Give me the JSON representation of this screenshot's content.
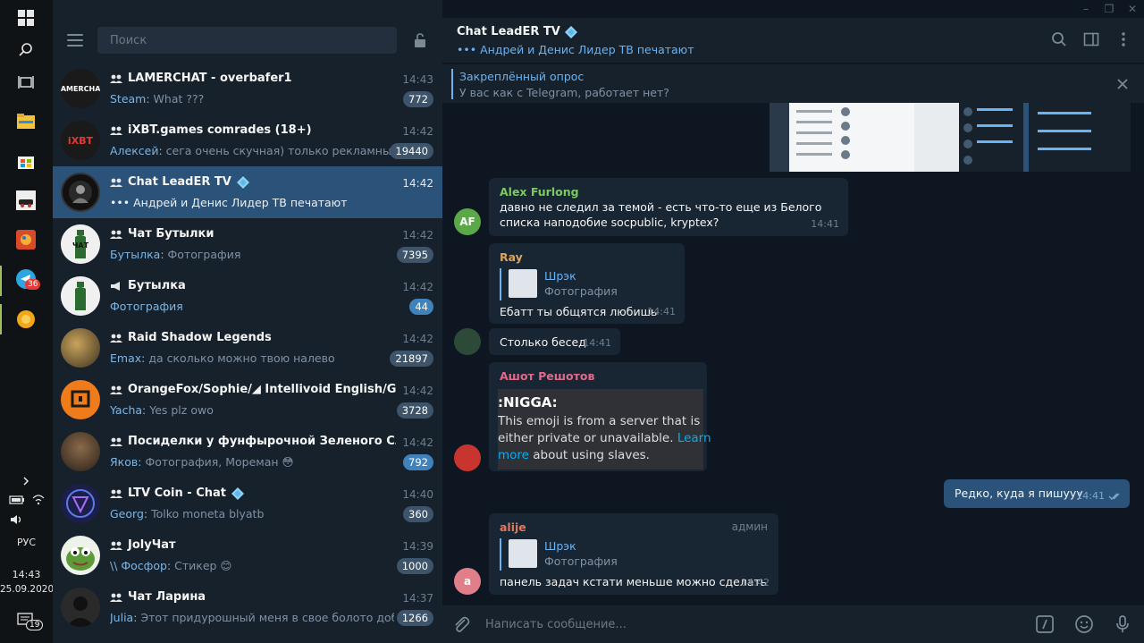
{
  "taskbar": {
    "tray_language": "РУС",
    "clock_time": "14:43",
    "clock_date": "25.09.2020",
    "telegram_badge": "36",
    "notifications_badge": "19"
  },
  "sidebar": {
    "search_placeholder": "Поиск",
    "chats": [
      {
        "name": "LAMERCHAT - overbafer1",
        "time": "14:43",
        "sender": "Steam:",
        "preview": " What ???",
        "badge": "772",
        "avatar_color": "#1a1a1a",
        "avatar_text": "LAMERCHAT",
        "type": "group",
        "badge_style": "muted"
      },
      {
        "name": "iXBT.games comrades (18+)",
        "time": "14:42",
        "sender": "Алексей:",
        "preview": " сега очень скучная) только рекламный ро...",
        "badge": "19440",
        "avatar_color": "#1a1a1a",
        "avatar_text": "iXBT",
        "type": "group",
        "badge_style": "muted"
      },
      {
        "name": "Chat LeadER TV",
        "time": "14:42",
        "sender": "",
        "preview": "••• Андрей и Денис Лидер ТВ печатают",
        "badge": "",
        "avatar_color": "#111111",
        "avatar_text": "",
        "type": "group",
        "verified": true,
        "active": true
      },
      {
        "name": "Чат Бутылки",
        "time": "14:42",
        "sender": "Бутылка:",
        "preview": " Фотография",
        "badge": "7395",
        "avatar_color": "#f0f0f0",
        "avatar_text": "ЧАТ",
        "type": "group",
        "badge_style": "muted"
      },
      {
        "name": "Бутылка",
        "time": "14:42",
        "sender": "",
        "preview": "Фотография",
        "badge": "44",
        "avatar_color": "#f0f0f0",
        "avatar_text": "",
        "type": "channel",
        "badge_style": "blue",
        "preview_blue": true
      },
      {
        "name": "Raid Shadow Legends",
        "time": "14:42",
        "sender": "Emax:",
        "preview": " да сколько можно твою налево",
        "badge": "21897",
        "avatar_color": "#6a5a3a",
        "avatar_text": "",
        "type": "group",
        "badge_style": "muted"
      },
      {
        "name": "OrangeFox/Sophie/◢ Intellivoid English/German OT",
        "time": "14:42",
        "sender": "Yacha:",
        "preview": " Yes plz owo",
        "badge": "3728",
        "avatar_color": "#ef7b1a",
        "avatar_text": "",
        "type": "group",
        "badge_style": "muted"
      },
      {
        "name": "Посиделки у фунфырочной Зеленого Слоника",
        "time": "14:42",
        "sender": "Яков:",
        "preview": " Фотография, Мореман 😳",
        "badge": "792",
        "avatar_color": "#4a3b2c",
        "avatar_text": "",
        "type": "group",
        "badge_style": "blue",
        "preview_mixed": true
      },
      {
        "name": "LTV Coin - Chat",
        "time": "14:40",
        "sender": "Georg:",
        "preview": " Tolko moneta blyatb",
        "badge": "360",
        "avatar_color": "#1b1f4a",
        "avatar_text": "",
        "type": "group",
        "verified": true,
        "badge_style": "muted"
      },
      {
        "name": "JolyЧат",
        "time": "14:39",
        "sender": "\\\\ Фосфор:",
        "preview": " Стикер 😊",
        "badge": "1000",
        "avatar_color": "#5d9a3a",
        "avatar_text": "",
        "type": "group",
        "badge_style": "muted"
      },
      {
        "name": "Чат Ларина",
        "time": "14:37",
        "sender": "Julia:",
        "preview": " Этот придурошный меня в свое болото добавил ...",
        "badge": "1266",
        "avatar_color": "#2a2a2a",
        "avatar_text": "",
        "type": "group",
        "badge_style": "muted"
      }
    ]
  },
  "chat": {
    "title": "Chat LeadER TV",
    "status": "••• Андрей и Денис Лидер ТВ печатают",
    "pinned_title": "Закреплённый опрос",
    "pinned_text": "У вас как с Telegram, работает нет?",
    "composer_placeholder": "Написать сообщение...",
    "messages": [
      {
        "sender": "Alex Furlong",
        "sender_color": "#7ec863",
        "avatar_text": "AF",
        "avatar_color": "#5aa848",
        "text": "давно не следил за темой - есть что-то еще из Белого списка наподобие socpublic, kryptex?",
        "time": "14:41"
      },
      {
        "sender": "Ray",
        "sender_color": "#e0a35a",
        "reply_name": "Шрэк",
        "reply_kind": "Фотография",
        "text": "Ебатт ты общятся любишь",
        "time": "14:41"
      },
      {
        "text": "Столько бесед",
        "time": "14:41"
      },
      {
        "sender": "Ашот Решотов",
        "sender_color": "#e06a8a",
        "embed_title": ":NIGGA:",
        "embed_text_1": "This emoji is from a server that is",
        "embed_text_2": "either private or unavailable. ",
        "embed_link_1": "Learn",
        "embed_link_2": "more",
        "embed_text_3": " about using slaves."
      },
      {
        "out_text": "Редко, куда я пишууу",
        "time": "14:41"
      },
      {
        "sender": "alije",
        "sender_color": "#e07a5f",
        "role": "админ",
        "avatar_text": "a",
        "avatar_color": "#e07f8a",
        "reply_name": "Шрэк",
        "reply_kind": "Фотография",
        "text": "панель задач кстати меньше можно сделать",
        "time": "14:42"
      }
    ]
  }
}
